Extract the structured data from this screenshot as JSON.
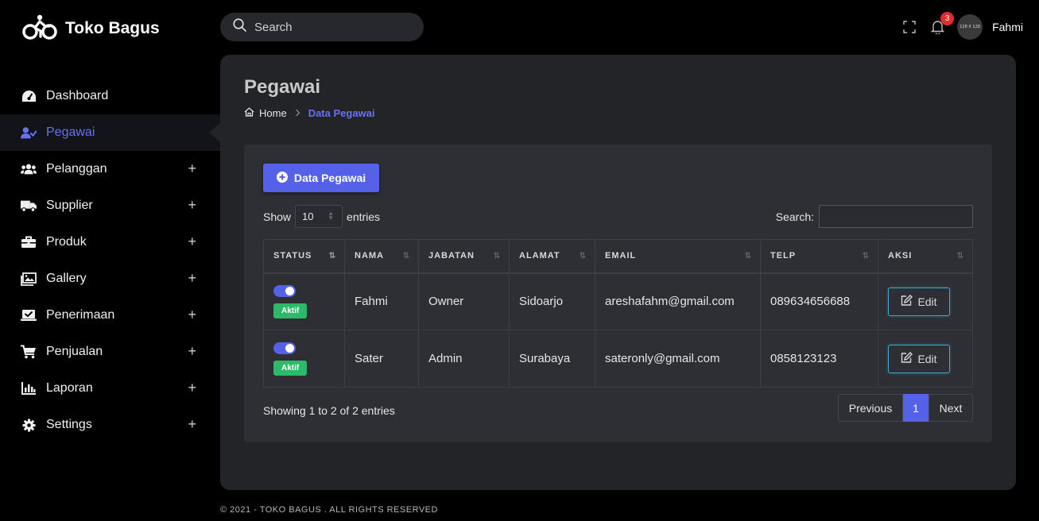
{
  "brand": {
    "name": "Toko Bagus",
    "icon": "bicycle-icon"
  },
  "sidebar": {
    "items": [
      {
        "label": "Dashboard",
        "icon": "speedometer-icon",
        "expandable": false,
        "active": false
      },
      {
        "label": "Pegawai",
        "icon": "user-check-icon",
        "expandable": false,
        "active": true
      },
      {
        "label": "Pelanggan",
        "icon": "users-icon",
        "expandable": true,
        "active": false
      },
      {
        "label": "Supplier",
        "icon": "truck-icon",
        "expandable": true,
        "active": false
      },
      {
        "label": "Produk",
        "icon": "briefcase-icon",
        "expandable": true,
        "active": false
      },
      {
        "label": "Gallery",
        "icon": "images-icon",
        "expandable": true,
        "active": false
      },
      {
        "label": "Penerimaan",
        "icon": "laptop-check-icon",
        "expandable": true,
        "active": false
      },
      {
        "label": "Penjualan",
        "icon": "cart-icon",
        "expandable": true,
        "active": false
      },
      {
        "label": "Laporan",
        "icon": "bar-chart-icon",
        "expandable": true,
        "active": false
      },
      {
        "label": "Settings",
        "icon": "gear-icon",
        "expandable": true,
        "active": false
      }
    ],
    "expand_symbol": "+"
  },
  "topbar": {
    "search_placeholder": "Search",
    "notification_count": "3",
    "avatar_text": "128 X 128",
    "user_name": "Fahmi"
  },
  "page": {
    "title": "Pegawai",
    "breadcrumb": {
      "home": "Home",
      "current": "Data Pegawai"
    }
  },
  "card": {
    "add_button": "Data Pegawai",
    "show_label": "Show",
    "entries_label": "entries",
    "page_length": "10",
    "search_label": "Search:",
    "columns": [
      "STATUS",
      "NAMA",
      "JABATAN",
      "ALAMAT",
      "EMAIL",
      "TELP",
      "AKSI"
    ],
    "rows": [
      {
        "status": "Aktif",
        "nama": "Fahmi",
        "jabatan": "Owner",
        "alamat": "Sidoarjo",
        "email": "areshafahm@gmail.com",
        "telp": "089634656688",
        "aksi": "Edit"
      },
      {
        "status": "Aktif",
        "nama": "Sater",
        "jabatan": "Admin",
        "alamat": "Surabaya",
        "email": "sateronly@gmail.com",
        "telp": "0858123123",
        "aksi": "Edit"
      }
    ],
    "info": "Showing 1 to 2 of 2 entries",
    "pagination": {
      "previous": "Previous",
      "current": "1",
      "next": "Next"
    }
  },
  "footer": "© 2021 - TOKO BAGUS . ALL RIGHTS RESERVED",
  "colors": {
    "accent": "#5561e8",
    "active_text": "#6772f0",
    "success": "#2cba6a",
    "danger": "#e02d2d",
    "edit_border": "#3fa9d9"
  }
}
